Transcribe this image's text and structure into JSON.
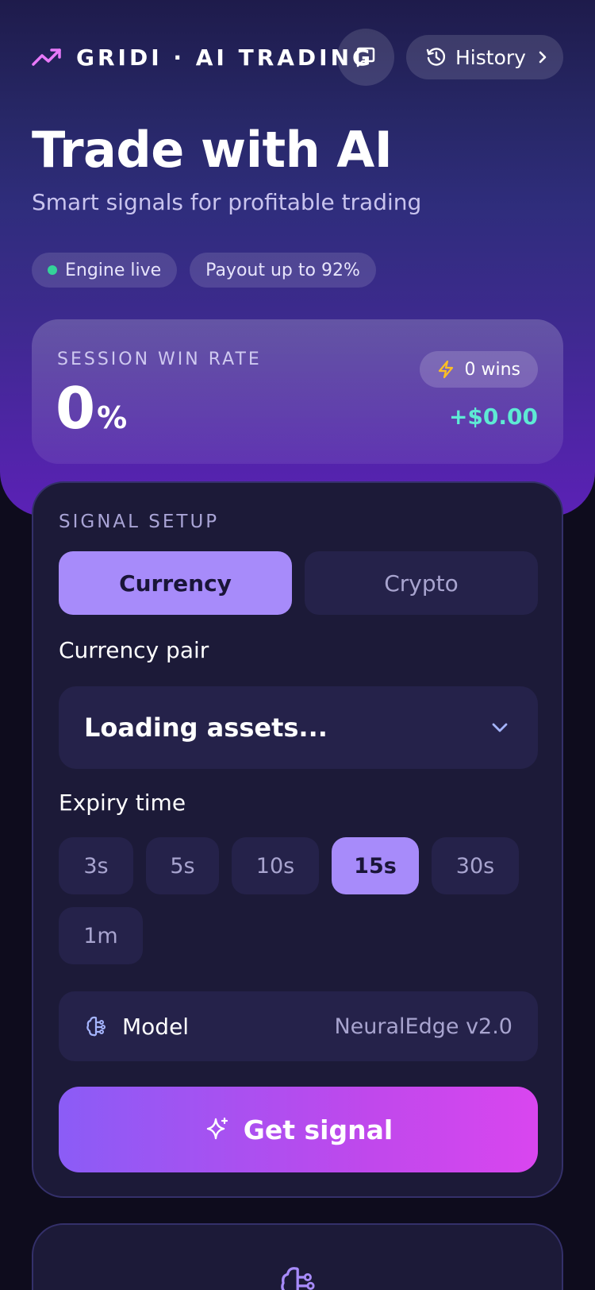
{
  "header": {
    "brand": "GRIDI · AI TRADING",
    "history_label": "History",
    "brand_icon": "trending-up-icon",
    "chat_icon": "chat-bubble-icon",
    "history_icon": "history-clock-icon"
  },
  "hero": {
    "title": "Trade with AI",
    "subtitle": "Smart signals for profitable trading",
    "pills": [
      {
        "label": "Engine live",
        "status_color": "#34d399"
      },
      {
        "label": "Payout up to 92%"
      }
    ]
  },
  "stats": {
    "label": "SESSION WIN RATE",
    "win_rate": "0",
    "unit": "%",
    "wins_label": "0 wins",
    "profit": "+$0.00"
  },
  "setup": {
    "title": "SIGNAL SETUP",
    "tabs": [
      {
        "label": "Currency",
        "active": true
      },
      {
        "label": "Crypto",
        "active": false
      }
    ],
    "pair_label": "Currency pair",
    "pair_value": "Loading assets...",
    "expiry_label": "Expiry time",
    "expiry_options": [
      {
        "label": "3s",
        "active": false
      },
      {
        "label": "5s",
        "active": false
      },
      {
        "label": "10s",
        "active": false
      },
      {
        "label": "15s",
        "active": true
      },
      {
        "label": "30s",
        "active": false
      },
      {
        "label": "1m",
        "active": false
      }
    ],
    "model_label": "Model",
    "model_value": "NeuralEdge v2.0",
    "cta_label": "Get signal"
  },
  "colors": {
    "accent": "#a78bfa",
    "profit": "#5eead4",
    "cta_start": "#8b5cf6",
    "cta_end": "#d946ef"
  }
}
